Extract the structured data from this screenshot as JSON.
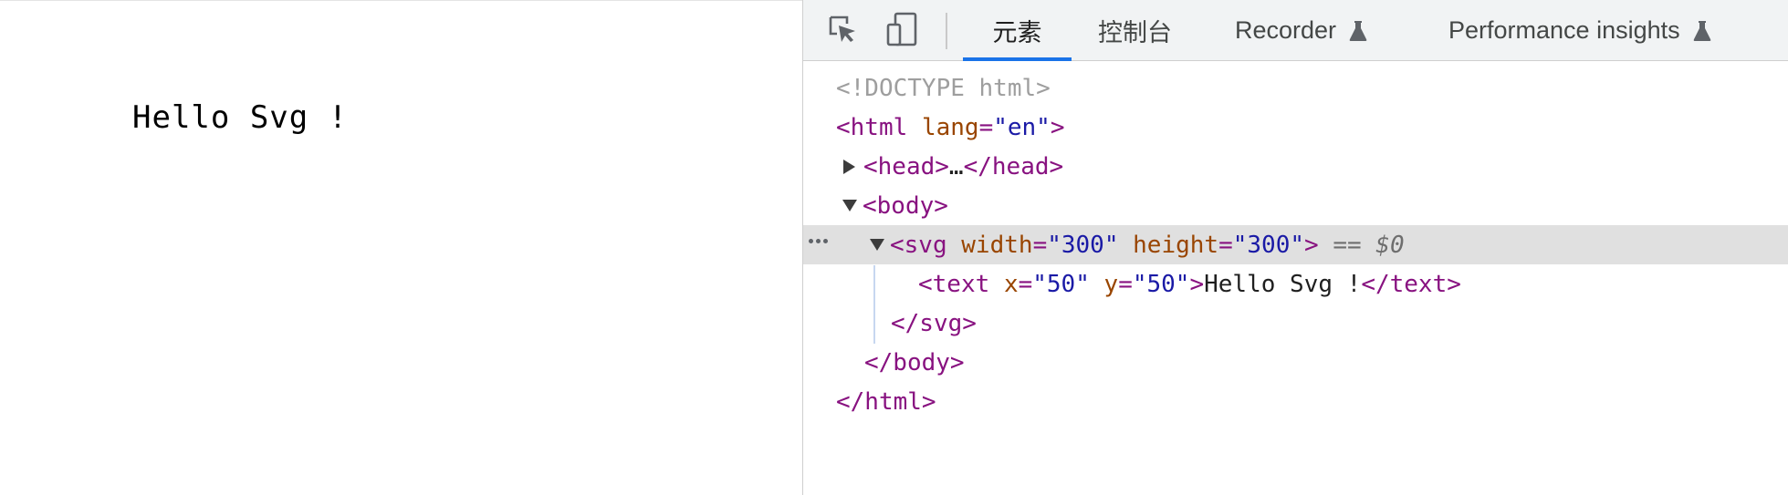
{
  "page": {
    "text": "Hello Svg !"
  },
  "devtools": {
    "tabs": [
      {
        "label": "元素",
        "active": true
      },
      {
        "label": "控制台",
        "active": false
      },
      {
        "label": "Recorder",
        "experimental": true
      },
      {
        "label": "Performance insights",
        "experimental": true
      }
    ],
    "icons": {
      "inspect": "inspect-element-icon",
      "device": "device-toolbar-icon",
      "flask": "flask-icon"
    },
    "accent_color": "#1a73e8"
  },
  "tree": {
    "doctype": "<!DOCTYPE html>",
    "html_open": "<html",
    "html_attr": "lang",
    "html_attr_val": "\"en\"",
    "html_close_bracket": ">",
    "head_collapsed": "<head>",
    "head_ellipsis": "…",
    "head_close": "</head>",
    "body_open": "<body>",
    "svg_open": "<svg",
    "svg_width_attr": "width",
    "svg_width_val": "\"300\"",
    "svg_height_attr": "height",
    "svg_height_val": "\"300\"",
    "svg_bracket": ">",
    "selected_marker": "== $0",
    "text_open": "<text",
    "text_x_attr": "x",
    "text_x_val": "\"50\"",
    "text_y_attr": "y",
    "text_y_val": "\"50\"",
    "text_bracket": ">",
    "text_content": "Hello Svg !",
    "text_close": "</text>",
    "svg_close": "</svg>",
    "body_close": "</body>",
    "html_close": "</html>",
    "eq": "="
  }
}
